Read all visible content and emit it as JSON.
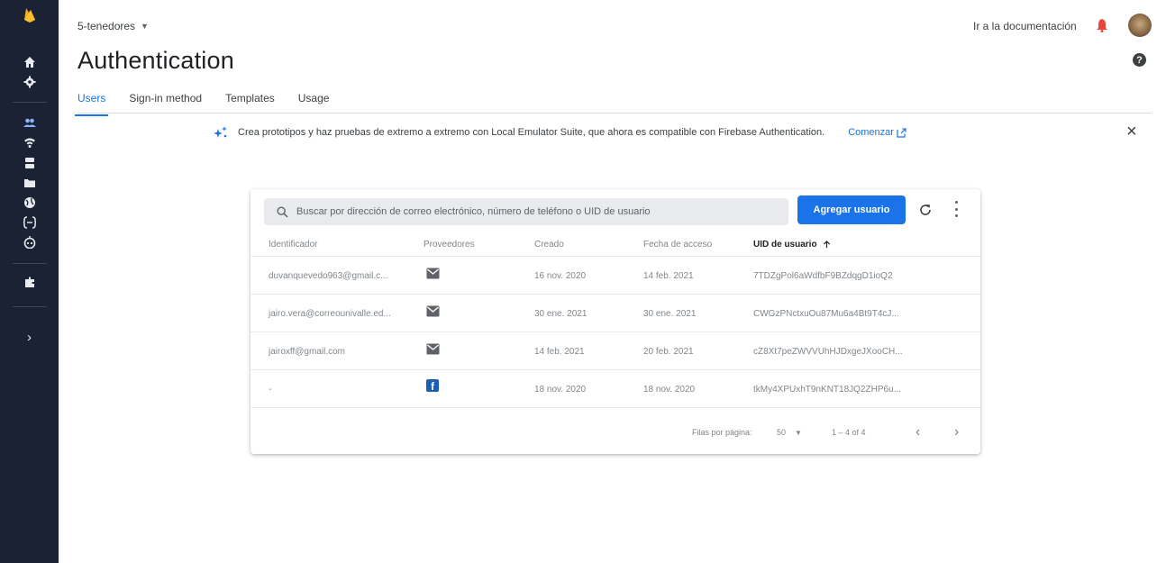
{
  "header": {
    "project_name": "5-tenedores",
    "doc_link": "Ir a la documentación",
    "page_title": "Authentication"
  },
  "tabs": [
    {
      "label": "Users",
      "active": true
    },
    {
      "label": "Sign-in method",
      "active": false
    },
    {
      "label": "Templates",
      "active": false
    },
    {
      "label": "Usage",
      "active": false
    }
  ],
  "banner": {
    "text": "Crea prototipos y haz pruebas de extremo a extremo con Local Emulator Suite, que ahora es compatible con Firebase Authentication.",
    "link": "Comenzar"
  },
  "users_table": {
    "search_placeholder": "Buscar por dirección de correo electrónico, número de teléfono o UID de usuario",
    "add_button": "Agregar usuario",
    "columns": [
      "Identificador",
      "Proveedores",
      "Creado",
      "Fecha de acceso",
      "UID de usuario"
    ],
    "rows": [
      {
        "id": "duvanquevedo963@gmail.c...",
        "provider": "email",
        "created": "16 nov. 2020",
        "signed_in": "14 feb. 2021",
        "uid": "7TDZgPol6aWdfbF9BZdqgD1ioQ2"
      },
      {
        "id": "jairo.vera@correounivalle.ed...",
        "provider": "email",
        "created": "30 ene. 2021",
        "signed_in": "30 ene. 2021",
        "uid": "CWGzPNctxuOu87Mu6a4Bt9T4cJ..."
      },
      {
        "id": "jairoxff@gmail.com",
        "provider": "email",
        "created": "14 feb. 2021",
        "signed_in": "20 feb. 2021",
        "uid": "cZ8Xt7peZWVVUhHJDxgeJXooCH..."
      },
      {
        "id": "-",
        "provider": "facebook",
        "created": "18 nov. 2020",
        "signed_in": "18 nov. 2020",
        "uid": "tkMy4XPUxhT9nKNT18JQ2ZHP6u..."
      }
    ],
    "footer": {
      "rows_per_page_label": "Filas por página:",
      "rows_per_page_value": "50",
      "range": "1 – 4 of 4"
    }
  },
  "icons": {
    "sidebar": [
      "firebase-logo-icon",
      "home-icon",
      "settings-icon",
      "users-icon",
      "wifi-icon",
      "database-icon",
      "storage-icon",
      "globe-icon",
      "functions-icon",
      "robot-icon",
      "extensions-icon",
      "expand-icon"
    ]
  },
  "colors": {
    "sidebar_bg": "#1a2234",
    "accent": "#1a73e8",
    "firebase_orange": "#f6a623",
    "notification": "#e8453c"
  }
}
